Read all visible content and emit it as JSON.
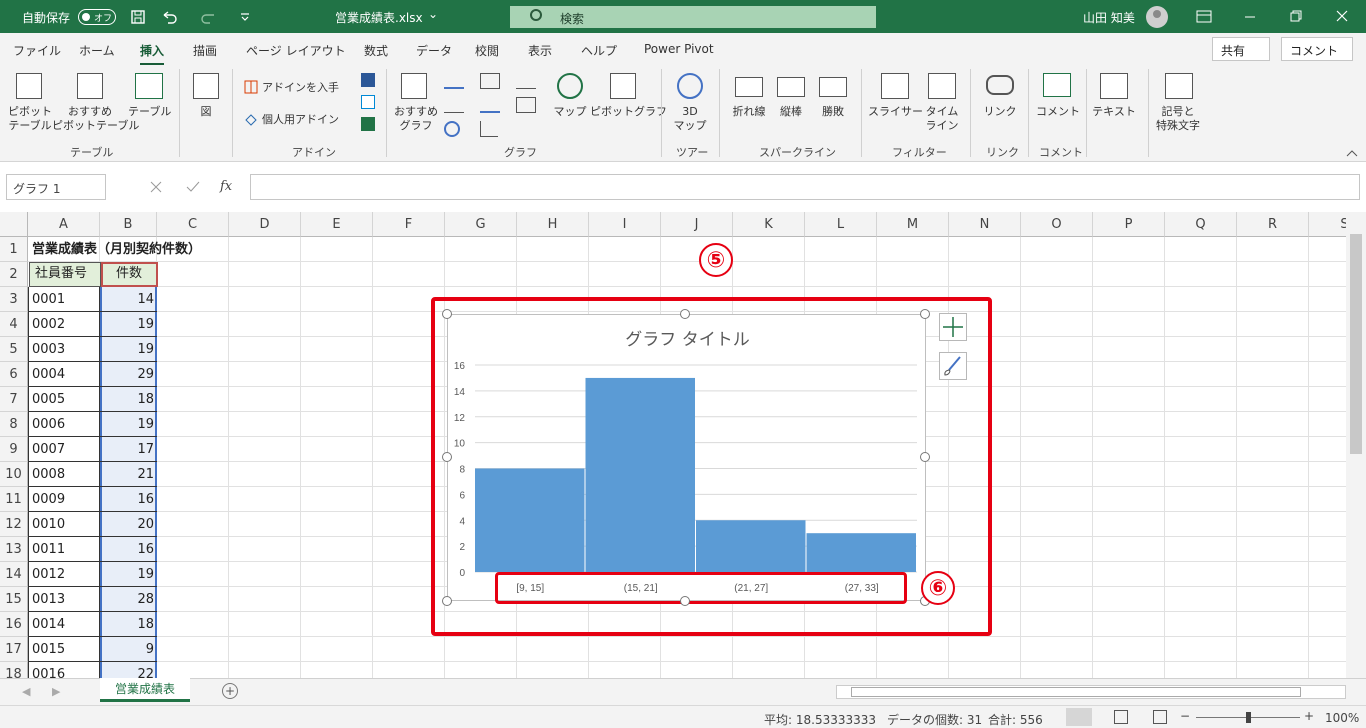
{
  "titlebar": {
    "autosave_label": "自動保存",
    "autosave_state": "オフ",
    "filename": "営業成績表.xlsx",
    "dropdown_glyph": "⌄",
    "search_placeholder": "検索",
    "user_name": "山田 知美"
  },
  "tabs": [
    "ファイル",
    "ホーム",
    "挿入",
    "描画",
    "ページ レイアウト",
    "数式",
    "データ",
    "校閲",
    "表示",
    "ヘルプ",
    "Power Pivot"
  ],
  "active_tab": "挿入",
  "share_label": "共有",
  "comment_label": "コメント",
  "ribbon": {
    "pivot_table": "ピボット\nテーブル",
    "recommended_pivot": "おすすめ\nピボットテーブル",
    "table": "テーブル",
    "illustrations": "図",
    "get_addins": "アドインを入手",
    "my_addins": "個人用アドイン",
    "recommended_charts": "おすすめ\nグラフ",
    "maps": "マップ",
    "pivot_chart": "ピボットグラフ",
    "map3d": "3D\nマップ",
    "sparkline_line": "折れ線",
    "sparkline_column": "縦棒",
    "sparkline_winloss": "勝敗",
    "slicer": "スライサー",
    "timeline": "タイム\nライン",
    "link": "リンク",
    "comment": "コメント",
    "text": "テキスト",
    "symbols": "記号と\n特殊文字",
    "groups": {
      "tables": "テーブル",
      "addins": "アドイン",
      "charts": "グラフ",
      "tours": "ツアー",
      "sparklines": "スパークライン",
      "filters": "フィルター",
      "links": "リンク",
      "comments": "コメント"
    }
  },
  "namebox": "グラフ 1",
  "fx_label": "fx",
  "columns": [
    "A",
    "B",
    "C",
    "D",
    "E",
    "F",
    "G",
    "H",
    "I",
    "J",
    "K",
    "L",
    "M",
    "N",
    "O",
    "P",
    "Q",
    "R",
    "S"
  ],
  "sheet": {
    "title": "営業成績表（月別契約件数）",
    "header_a": "社員番号",
    "header_b": "件数",
    "rows": [
      {
        "row": "3",
        "id": "0001",
        "count": "14"
      },
      {
        "row": "4",
        "id": "0002",
        "count": "19"
      },
      {
        "row": "5",
        "id": "0003",
        "count": "19"
      },
      {
        "row": "6",
        "id": "0004",
        "count": "29"
      },
      {
        "row": "7",
        "id": "0005",
        "count": "18"
      },
      {
        "row": "8",
        "id": "0006",
        "count": "19"
      },
      {
        "row": "9",
        "id": "0007",
        "count": "17"
      },
      {
        "row": "10",
        "id": "0008",
        "count": "21"
      },
      {
        "row": "11",
        "id": "0009",
        "count": "16"
      },
      {
        "row": "12",
        "id": "0010",
        "count": "20"
      },
      {
        "row": "13",
        "id": "0011",
        "count": "16"
      },
      {
        "row": "14",
        "id": "0012",
        "count": "19"
      },
      {
        "row": "15",
        "id": "0013",
        "count": "28"
      },
      {
        "row": "16",
        "id": "0014",
        "count": "18"
      },
      {
        "row": "17",
        "id": "0015",
        "count": "9"
      },
      {
        "row": "18",
        "id": "0016",
        "count": "22"
      }
    ]
  },
  "chart_data": {
    "type": "bar",
    "title": "グラフ タイトル",
    "categories": [
      "[9, 15]",
      "(15, 21]",
      "(21, 27]",
      "(27, 33]"
    ],
    "values": [
      8,
      15,
      4,
      3
    ],
    "ylim": [
      0,
      16
    ],
    "yticks": [
      0,
      2,
      4,
      6,
      8,
      10,
      12,
      14,
      16
    ],
    "bar_color": "#5b9bd5",
    "grid": true
  },
  "annotations": {
    "step5": "⑤",
    "step6": "⑥",
    "color": "#e60012"
  },
  "sheet_tab": "営業成績表",
  "status": {
    "average": "平均: 18.53333333",
    "count": "データの個数: 31",
    "sum": "合計: 556",
    "zoom": "100%"
  }
}
